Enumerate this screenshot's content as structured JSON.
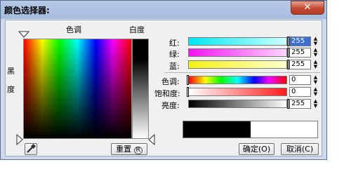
{
  "window": {
    "title": "颜色选择器:",
    "close_glyph": "✕"
  },
  "picker": {
    "hue_label": "色调",
    "brightness_label": "白度",
    "black_label_1": "黑",
    "black_label_2": "度",
    "reset_label": "重置",
    "reset_key": "R",
    "eyedropper_icon": "eyedropper-icon"
  },
  "rgb": [
    {
      "label": "红:",
      "value": "255",
      "from": "#00e7f0",
      "to": "#ccffff"
    },
    {
      "label": "绿:",
      "value": "255",
      "from": "#f012f0",
      "to": "#ffd6ff"
    },
    {
      "label": "蓝:",
      "value": "255",
      "from": "#f2f214",
      "to": "#ffffd0"
    }
  ],
  "hsv": [
    {
      "label": "色调:",
      "value": "0"
    },
    {
      "label": "饱和度:",
      "value": "0"
    },
    {
      "label": "亮度:",
      "value": "255"
    }
  ],
  "preview": {
    "old_color": "#000000",
    "new_color": "#ffffff"
  },
  "buttons": {
    "ok_label": "确定",
    "ok_key": "O",
    "cancel_label": "取消",
    "cancel_key": "C"
  }
}
